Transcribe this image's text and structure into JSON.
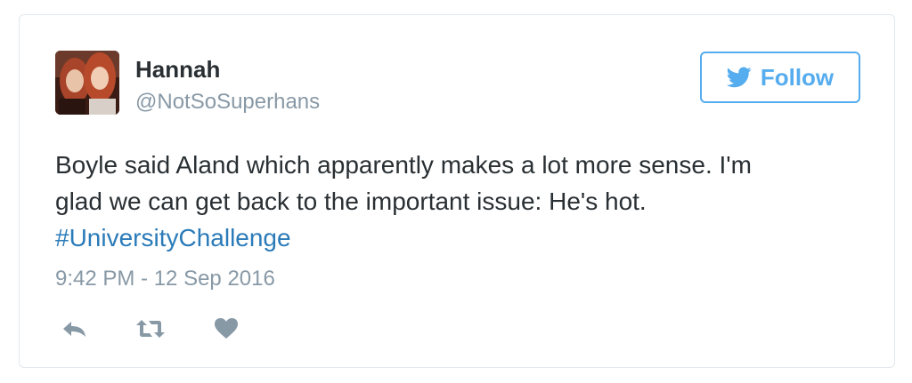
{
  "tweet": {
    "author": {
      "name": "Hannah",
      "handle": "@NotSoSuperhans"
    },
    "follow_label": "Follow",
    "text_lines": [
      "Boyle said Aland which apparently makes a lot more sense. I'm",
      "glad we can get back to the important issue: He's hot."
    ],
    "hashtag": "#UniversityChallenge",
    "timestamp": "9:42 PM - 12 Sep 2016",
    "actions": [
      {
        "icon": "reply-icon"
      },
      {
        "icon": "retweet-icon"
      },
      {
        "icon": "like-heart-icon"
      }
    ],
    "colors": {
      "accent": "#55acee",
      "link": "#2b7bb9",
      "text": "#292f33",
      "muted": "#8899a6",
      "border": "#e1e8ed"
    }
  }
}
